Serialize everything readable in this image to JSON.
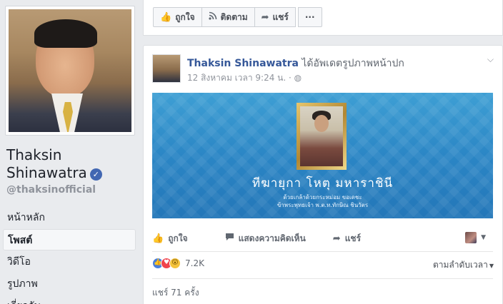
{
  "page": {
    "name": "Thaksin Shinawatra",
    "name_line1": "Thaksin",
    "name_line2": "Shinawatra",
    "handle": "@thaksinofficial",
    "verified_icon": "verified-check-icon"
  },
  "nav": {
    "items": [
      {
        "label": "หน้าหลัก",
        "active": false
      },
      {
        "label": "โพสต์",
        "active": true
      },
      {
        "label": "วิดีโอ",
        "active": false
      },
      {
        "label": "รูปภาพ",
        "active": false
      },
      {
        "label": "เกี่ยวกับ",
        "active": false
      }
    ]
  },
  "action_bar": {
    "like_label": "ถูกใจ",
    "follow_label": "ติดตาม",
    "share_label": "แชร์",
    "more_label": "···"
  },
  "post": {
    "author": "Thaksin Shinawatra",
    "action_text": "ได้อัพเดตรูปภาพหน้าปก",
    "timestamp": "12 สิงหาคม เวลา 9:24 น.",
    "privacy_icon": "globe-icon",
    "cover": {
      "title": "ทีฆายุกา โหตุ มหาราชินี",
      "subtitle_line1": "ด้วยเกล้าด้วยกระหม่อม ขอเดชะ",
      "subtitle_line2": "ข้าพระพุทธเจ้า พ.ต.ท.ทักษิณ ชินวัตร"
    },
    "actions": {
      "like_label": "ถูกใจ",
      "comment_label": "แสดงความคิดเห็น",
      "share_label": "แชร์"
    },
    "reactions": {
      "count": "7.2K",
      "types": [
        "like",
        "love",
        "wow"
      ]
    },
    "sort_label": "ตามลำดับเวลา",
    "shares_text": "แชร์ 71 ครั้ง"
  },
  "colors": {
    "link": "#365899",
    "brand": "#4267b2",
    "background": "#e9ebee"
  }
}
